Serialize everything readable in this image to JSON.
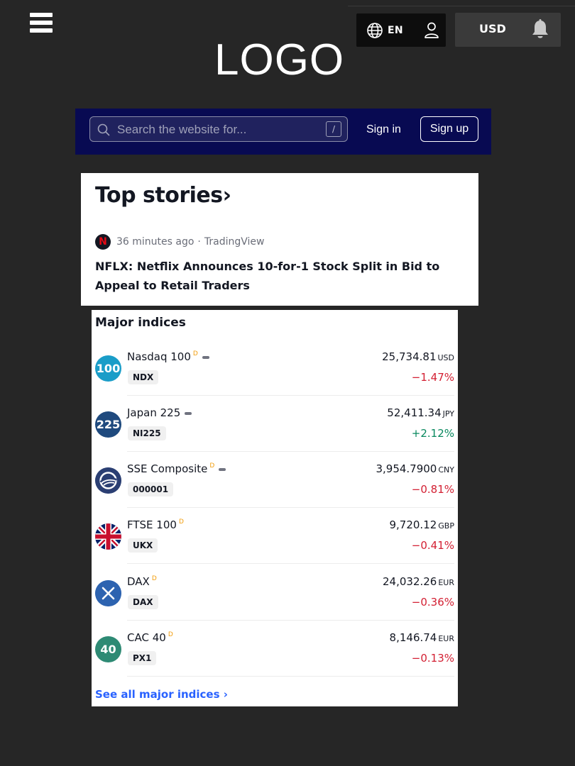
{
  "header": {
    "language": "EN",
    "currency": "USD",
    "logo": "LOGO"
  },
  "search": {
    "placeholder": "Search the website for...",
    "shortcut": "/",
    "signin_label": "Sign in",
    "signup_label": "Sign up"
  },
  "top_stories": {
    "title": "Top stories",
    "chevron": "›",
    "story": {
      "source_icon": "N",
      "time": "36 minutes ago",
      "separator": "·",
      "source": "TradingView",
      "headline": "NFLX: Netflix Announces 10-for-1 Stock Split in Bid to Appeal to Retail Traders"
    }
  },
  "major_indices": {
    "title": "Major indices",
    "see_all": "See all major indices ›",
    "items": [
      {
        "icon_text": "100",
        "icon_color": "#1a9dc8",
        "name": "Nasdaq 100",
        "delayed": "D",
        "ticker": "NDX",
        "price": "25,734.81",
        "currency": "USD",
        "change": "−1.47%",
        "direction": "neg"
      },
      {
        "icon_text": "225",
        "icon_color": "#1f4a7e",
        "name": "Japan 225",
        "delayed": "",
        "ticker": "NI225",
        "price": "52,411.34",
        "currency": "JPY",
        "change": "+2.12%",
        "direction": "pos"
      },
      {
        "icon_text": "",
        "icon_color": "#2b3f73",
        "name": "SSE Composite",
        "delayed": "D",
        "ticker": "000001",
        "price": "3,954.7900",
        "currency": "CNY",
        "change": "−0.81%",
        "direction": "neg"
      },
      {
        "icon_text": "",
        "icon_color": "#012169",
        "name": "FTSE 100",
        "delayed": "D",
        "ticker": "UKX",
        "price": "9,720.12",
        "currency": "GBP",
        "change": "−0.41%",
        "direction": "neg"
      },
      {
        "icon_text": "",
        "icon_color": "#2d63b0",
        "name": "DAX",
        "delayed": "D",
        "ticker": "DAX",
        "price": "24,032.26",
        "currency": "EUR",
        "change": "−0.36%",
        "direction": "neg"
      },
      {
        "icon_text": "40",
        "icon_color": "#2e8a74",
        "name": "CAC 40",
        "delayed": "D",
        "ticker": "PX1",
        "price": "8,146.74",
        "currency": "EUR",
        "change": "−0.13%",
        "direction": "neg"
      }
    ]
  }
}
